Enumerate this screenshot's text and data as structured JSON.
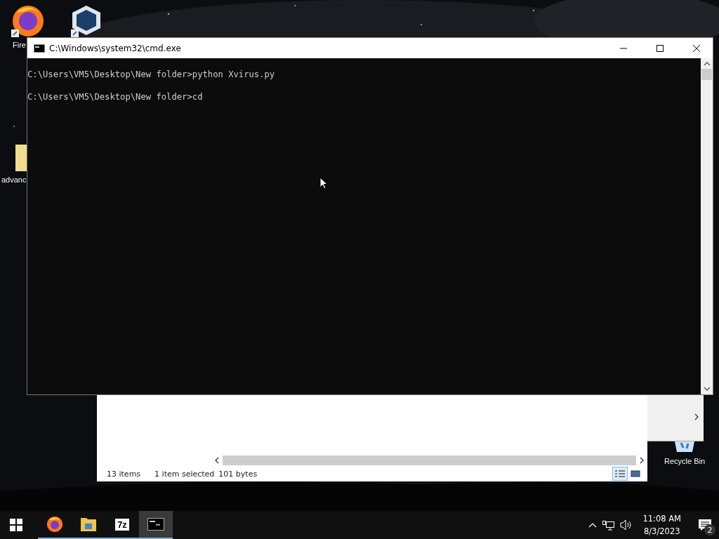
{
  "desktop": {
    "icons": [
      {
        "kind": "browser",
        "label": "Fire"
      },
      {
        "kind": "box"
      },
      {
        "kind": "folder",
        "label": "advanc"
      },
      {
        "kind": "recycle",
        "label": "Recycle Bin"
      }
    ]
  },
  "cmd_window": {
    "title": "C:\\Windows\\system32\\cmd.exe",
    "lines": [
      "C:\\Users\\VM5\\Desktop\\New folder>python Xvirus.py",
      "C:\\Users\\VM5\\Desktop\\New folder>cd"
    ]
  },
  "explorer_window": {
    "status_bar": [
      "13 items",
      "1 item selected",
      "101 bytes"
    ],
    "views": [
      {
        "kind": "details",
        "selected": true
      },
      {
        "kind": "tiles",
        "selected": false
      }
    ]
  },
  "taskbar": {
    "apps": [
      {
        "kind": "browser",
        "selected": false
      },
      {
        "kind": "folder",
        "selected": false
      },
      {
        "kind": "archive",
        "label": "7z",
        "selected": false
      },
      {
        "kind": "terminal",
        "selected": true
      }
    ],
    "time": "11:08 AM",
    "date": "8/3/2023",
    "notifications": "2"
  }
}
